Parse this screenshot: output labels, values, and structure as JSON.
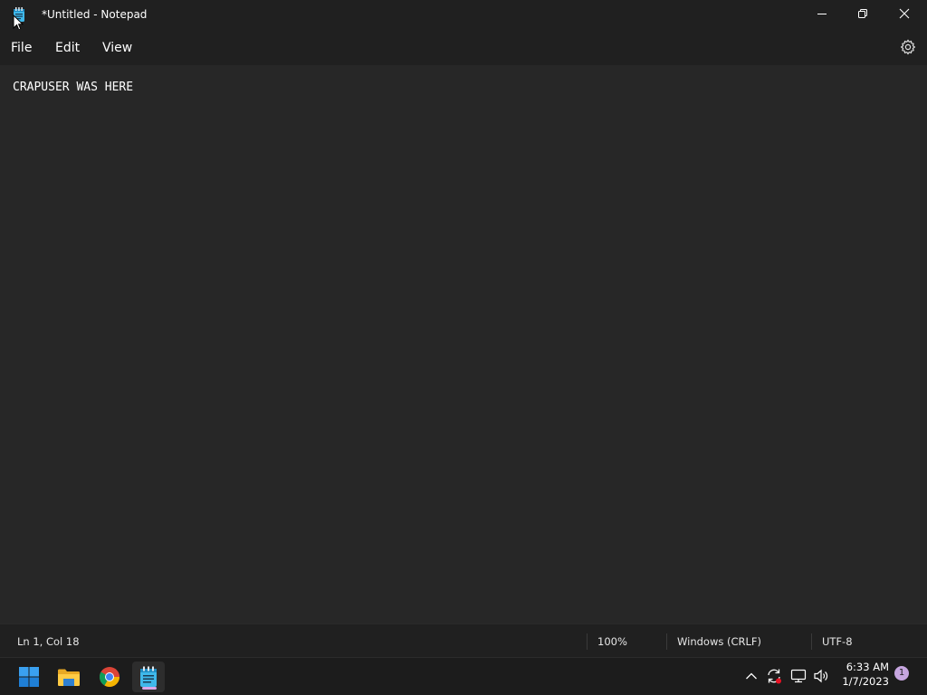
{
  "window": {
    "title": "*Untitled - Notepad",
    "app_icon": "notepad-icon"
  },
  "menu": {
    "items": [
      {
        "label": "File"
      },
      {
        "label": "Edit"
      },
      {
        "label": "View"
      }
    ],
    "settings_icon": "gear-icon"
  },
  "editor": {
    "content": "CRAPUSER WAS HERE"
  },
  "statusbar": {
    "position": "Ln 1, Col 18",
    "zoom": "100%",
    "line_ending": "Windows (CRLF)",
    "encoding": "UTF-8"
  },
  "taskbar": {
    "apps": [
      {
        "name": "start",
        "icon": "windows-start-icon"
      },
      {
        "name": "file-explorer",
        "icon": "folder-icon"
      },
      {
        "name": "chrome",
        "icon": "chrome-icon"
      },
      {
        "name": "notepad",
        "icon": "notepad-icon",
        "active": true
      }
    ],
    "tray": {
      "icons": [
        "chevron-up-icon",
        "sync-icon",
        "network-icon",
        "volume-icon"
      ]
    },
    "clock": {
      "time": "6:33 AM",
      "date": "1/7/2023"
    },
    "notifications": "1"
  },
  "colors": {
    "titlebar_bg": "#202020",
    "editor_bg": "#272727",
    "taskbar_bg": "#1c1c1c",
    "accent": "#c7a6e0"
  }
}
